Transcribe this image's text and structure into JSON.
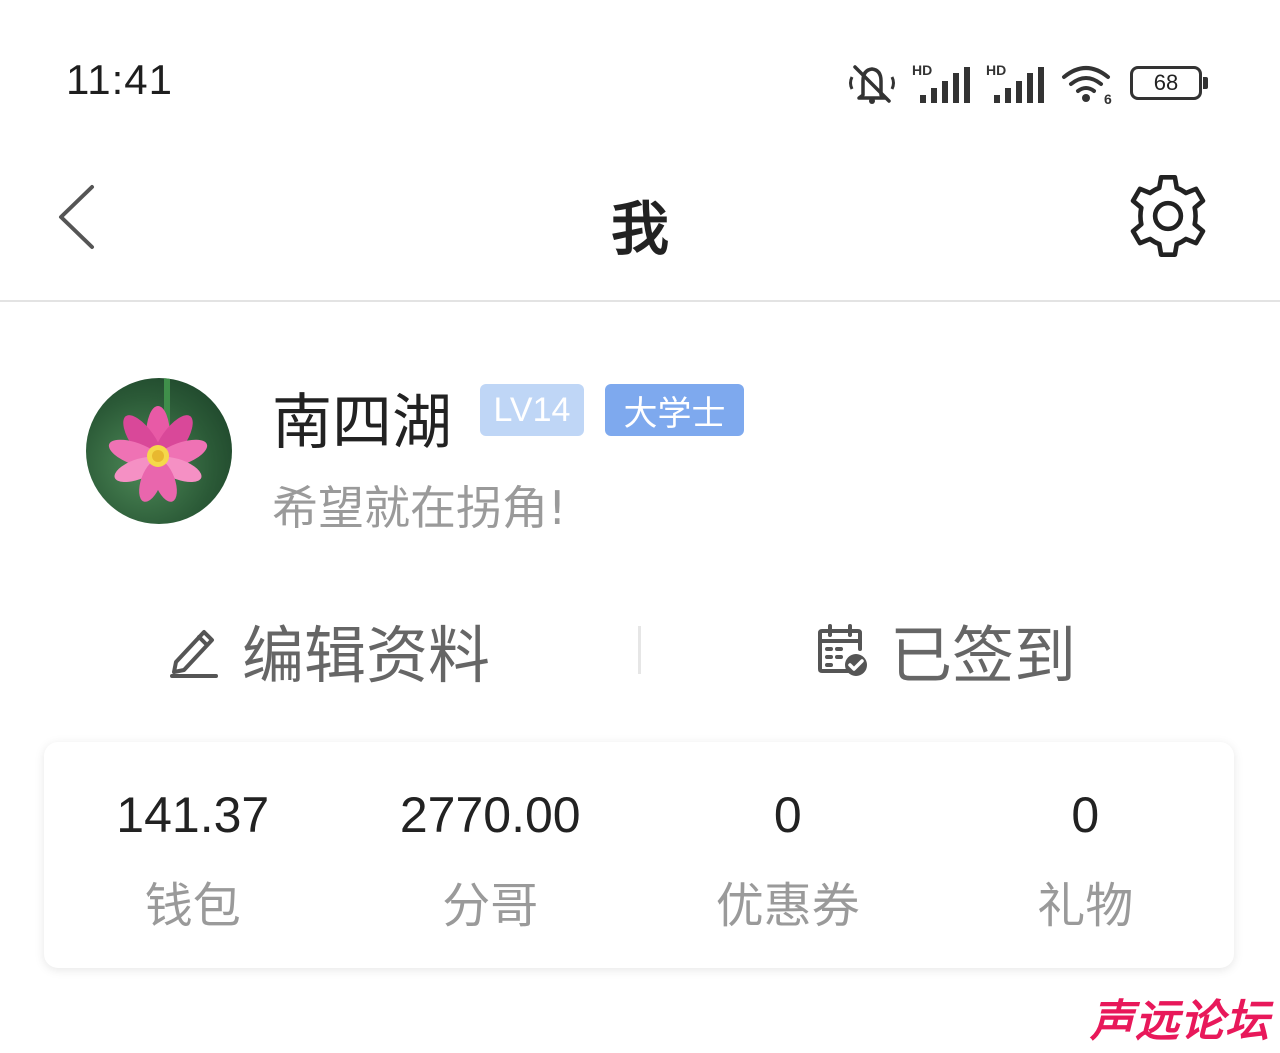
{
  "status_bar": {
    "time": "11:41",
    "battery_level": "68",
    "icons": [
      "mute-icon",
      "hd-signal-icon",
      "hd-signal-icon",
      "wifi-icon",
      "battery-icon"
    ],
    "wifi_badge": "6",
    "hd_label": "HD"
  },
  "nav": {
    "title": "我",
    "back_icon": "chevron-left-icon",
    "settings_icon": "gear-icon"
  },
  "profile": {
    "username": "南四湖",
    "level_badge": "LV14",
    "title_badge": "大学士",
    "signature": "希望就在拐角!",
    "badge_colors": {
      "level": "#bfd6f6",
      "title": "#7ea9ee"
    }
  },
  "actions": {
    "edit": {
      "label": "编辑资料",
      "icon": "pencil-icon"
    },
    "checkin": {
      "label": "已签到",
      "icon": "calendar-check-icon"
    }
  },
  "stats": [
    {
      "value": "141.37",
      "label": "钱包"
    },
    {
      "value": "2770.00",
      "label": "分哥"
    },
    {
      "value": "0",
      "label": "优惠券"
    },
    {
      "value": "0",
      "label": "礼物"
    }
  ],
  "watermark": {
    "text": "声远论坛",
    "color": "#e8185a"
  }
}
